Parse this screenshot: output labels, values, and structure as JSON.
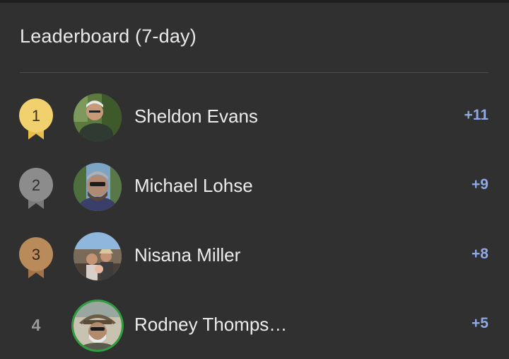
{
  "leaderboard": {
    "title": "Leaderboard (7-day)",
    "entries": [
      {
        "rank": "1",
        "name": "Sheldon Evans",
        "score": "+11",
        "medal_color": "#f1d06e",
        "medal_text_color": "#3a2f10"
      },
      {
        "rank": "2",
        "name": "Michael Lohse",
        "score": "+9",
        "medal_color": "#8c8c8c",
        "medal_text_color": "#2e2e2e"
      },
      {
        "rank": "3",
        "name": "Nisana Miller",
        "score": "+8",
        "medal_color": "#b98a5a",
        "medal_text_color": "#3a2716"
      },
      {
        "rank": "4",
        "name": "Rodney Thomps…",
        "score": "+5"
      }
    ]
  },
  "colors": {
    "background": "#303030",
    "score": "#8fa8e6",
    "avatar_ring": "#2e9e3e"
  }
}
